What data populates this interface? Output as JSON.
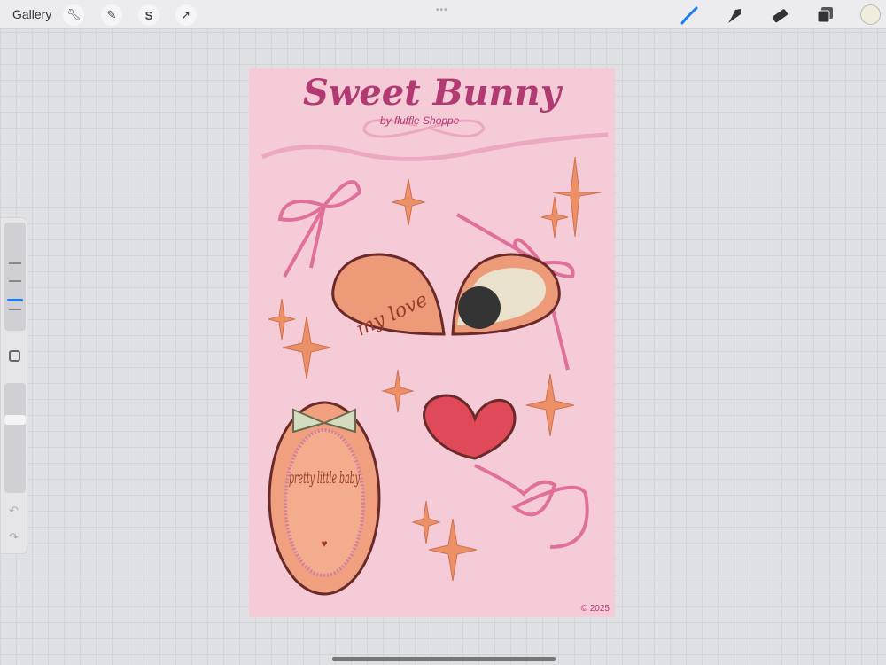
{
  "toolbar": {
    "gallery_label": "Gallery",
    "left_tools": [
      "wrench-icon",
      "magic-wand-icon",
      "selection-icon",
      "transform-icon"
    ],
    "right_tools": [
      "brush-icon",
      "smudge-icon",
      "eraser-icon",
      "layers-icon"
    ],
    "active_tool": "brush",
    "current_color": "#f1ecdc",
    "accent": "#1a7ef2"
  },
  "artwork": {
    "title": "Sweet Bunny",
    "byline": "by fluffle Shoppe",
    "copyright": "© 2025",
    "locket_text": "my love",
    "mirror_text": "pretty little baby"
  }
}
